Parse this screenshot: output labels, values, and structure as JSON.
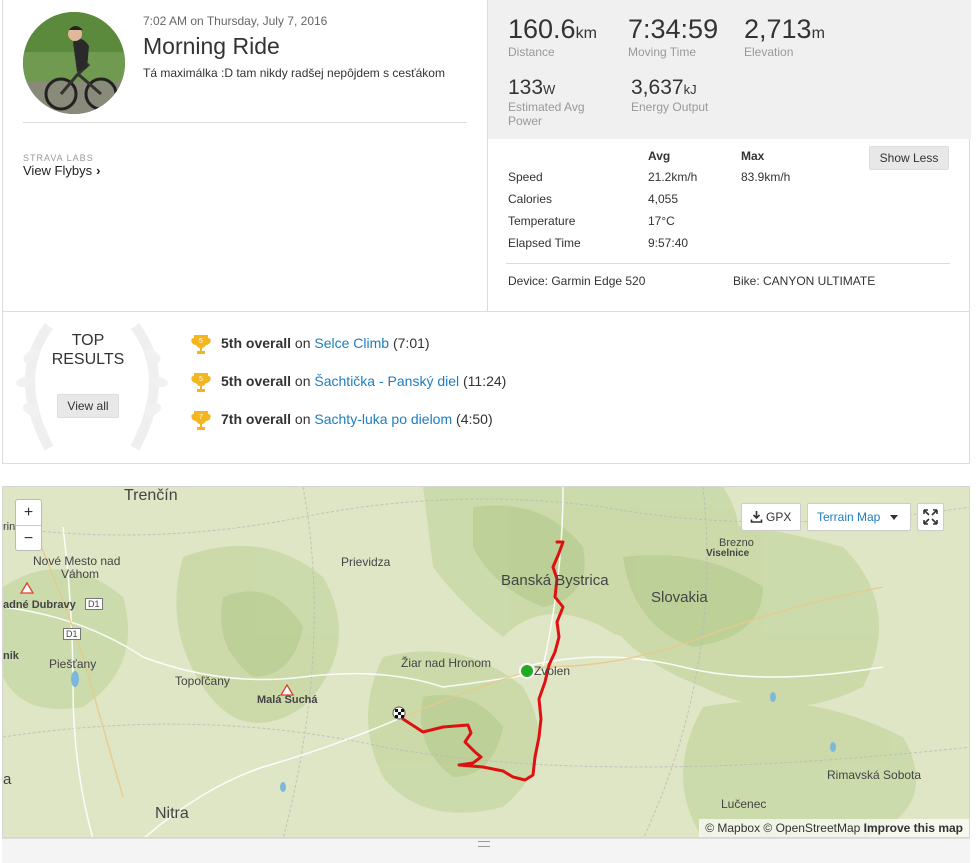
{
  "activity": {
    "timestamp": "7:02 AM on Thursday, July 7, 2016",
    "title": "Morning Ride",
    "description": "Tá maximálka :D tam nikdy radšej nepôjdem s cesťákom"
  },
  "labs": {
    "kicker": "STRAVA LABS",
    "link": "View Flybys"
  },
  "stats": {
    "distance": {
      "value": "160.6",
      "unit": "km",
      "label": "Distance"
    },
    "moving_time": {
      "value": "7:34:59",
      "label": "Moving Time"
    },
    "elevation": {
      "value": "2,713",
      "unit": "m",
      "label": "Elevation"
    },
    "power": {
      "value": "133",
      "unit": "W",
      "label_line1": "Estimated Avg",
      "label_line2": "Power"
    },
    "energy": {
      "value": "3,637",
      "unit": "kJ",
      "label": "Energy Output"
    }
  },
  "more_stats": {
    "col_avg": "Avg",
    "col_max": "Max",
    "show_less": "Show Less",
    "rows": [
      {
        "label": "Speed",
        "avg": "21.2km/h",
        "max": "83.9km/h"
      },
      {
        "label": "Calories",
        "avg": "4,055",
        "max": ""
      },
      {
        "label": "Temperature",
        "avg": "17°C",
        "max": ""
      },
      {
        "label": "Elapsed Time",
        "avg": "9:57:40",
        "max": ""
      }
    ],
    "device": "Device: Garmin Edge 520",
    "bike": "Bike: CANYON ULTIMATE"
  },
  "top_results": {
    "heading_line1": "TOP",
    "heading_line2": "RESULTS",
    "view_all": "View all",
    "items": [
      {
        "rank": "5",
        "place": "5th overall",
        "on": "on",
        "segment": "Selce Climb",
        "time": "(7:01)"
      },
      {
        "rank": "5",
        "place": "5th overall",
        "on": "on",
        "segment": "Šachtička - Panský diel",
        "time": "(11:24)"
      },
      {
        "rank": "7",
        "place": "7th overall",
        "on": "on",
        "segment": "Sachty-luka po dielom",
        "time": "(4:50)"
      }
    ]
  },
  "map": {
    "zoom_in": "+",
    "zoom_out": "−",
    "gpx": "GPX",
    "map_type": "Terrain Map",
    "labels": {
      "trencin": "Trenčín",
      "rina": "rina",
      "nove_mesto": "Nové Mesto nad",
      "vahom": "Váhom",
      "dubravy": "adné Dubravy",
      "d1a": "D1",
      "d1b": "D1",
      "nik": "nik",
      "piestany": "Piešťany",
      "prievidza": "Prievidza",
      "banska": "Banská Bystrica",
      "brezno": "Brezno",
      "viselnice": "Viselnice",
      "slovakia": "Slovakia",
      "ziar": "Žiar nad Hronom",
      "zvolen": "Zvolen",
      "topolcany": "Topoľčany",
      "mala_sucha": "Malá Suchá",
      "nitra": "Nitra",
      "a": "a",
      "rimavska": "Rimavská Sobota",
      "lucenec": "Lučenec"
    },
    "attribution": "© Mapbox © OpenStreetMap",
    "improve": "Improve this map"
  }
}
